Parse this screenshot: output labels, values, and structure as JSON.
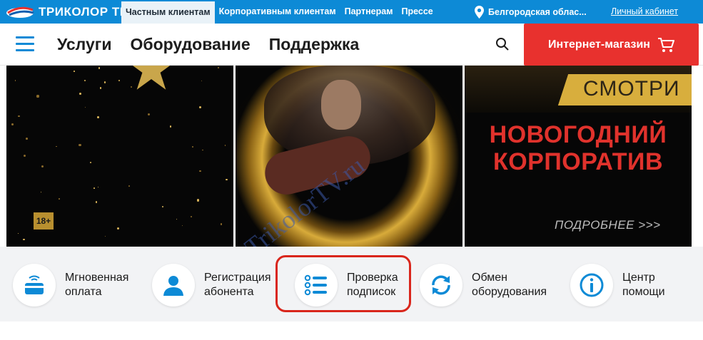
{
  "topbar": {
    "logo_text": "ТРИКОЛОР ТВ",
    "nav": [
      {
        "label": "Частным клиентам",
        "active": true
      },
      {
        "label": "Корпоративным клиентам",
        "active": false
      },
      {
        "label": "Партнерам",
        "active": false
      },
      {
        "label": "Прессе",
        "active": false
      }
    ],
    "region": "Белгородская облас...",
    "cabinet": "Личный кабинет"
  },
  "mainnav": {
    "items": [
      "Услуги",
      "Оборудование",
      "Поддержка"
    ],
    "shop_label": "Интернет-магазин"
  },
  "banners": {
    "b1_age": "18+",
    "b3_smotri": "СМОТРИ",
    "b3_title_1": "НОВОГОДНИЙ",
    "b3_title_2": "КОРПОРАТИВ",
    "b3_more": "ПОДРОБНЕЕ >>>",
    "watermark": "OTrikolorTV.ru"
  },
  "services": [
    {
      "line1": "Мгновенная",
      "line2": "оплата",
      "icon": "wallet-icon"
    },
    {
      "line1": "Регистрация",
      "line2": "абонента",
      "icon": "user-icon"
    },
    {
      "line1": "Проверка",
      "line2": "подписок",
      "icon": "list-icon"
    },
    {
      "line1": "Обмен",
      "line2": "оборудования",
      "icon": "exchange-icon"
    },
    {
      "line1": "Центр",
      "line2": "помощи",
      "icon": "info-icon"
    }
  ],
  "colors": {
    "brand_blue": "#0d8ad6",
    "shop_red": "#e8312e",
    "highlight_red": "#d9261c"
  }
}
